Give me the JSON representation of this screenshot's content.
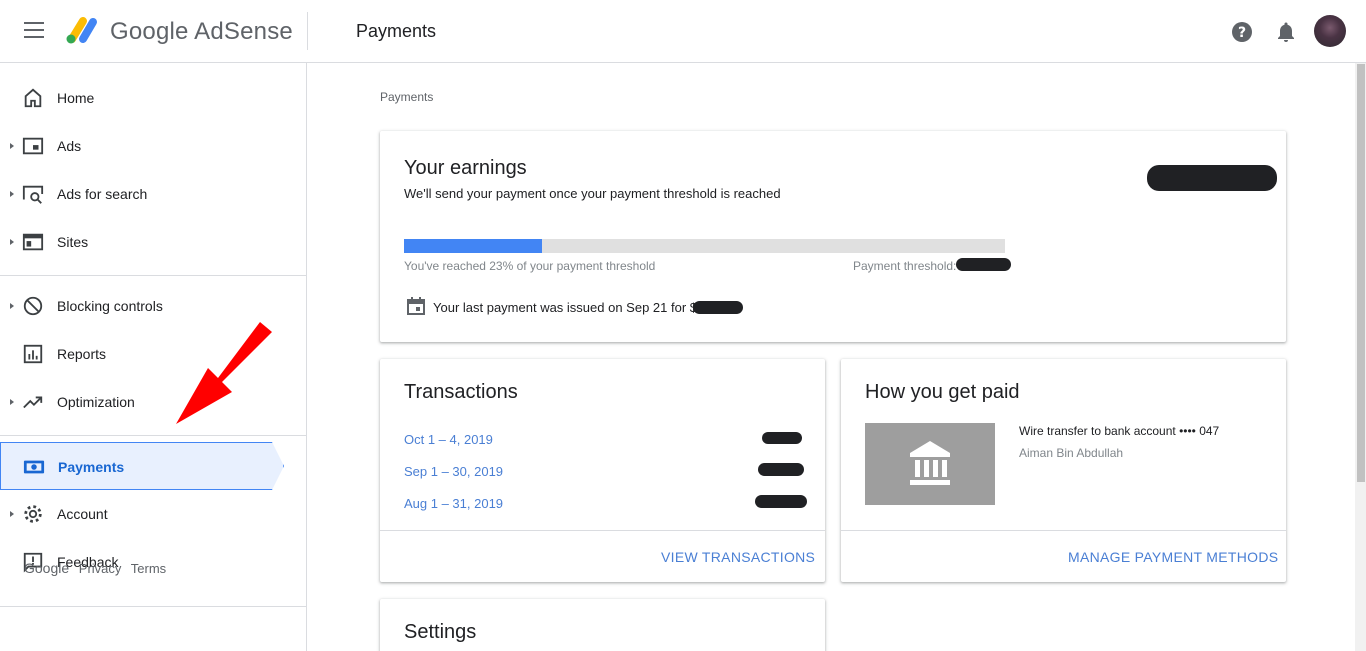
{
  "header": {
    "brand": "Google AdSense",
    "title": "Payments"
  },
  "sidebar": {
    "items": [
      {
        "label": "Home",
        "icon": "home-icon"
      },
      {
        "label": "Ads",
        "icon": "ads-icon"
      },
      {
        "label": "Ads for search",
        "icon": "ads-search-icon"
      },
      {
        "label": "Sites",
        "icon": "sites-icon"
      },
      {
        "label": "Blocking controls",
        "icon": "block-icon"
      },
      {
        "label": "Reports",
        "icon": "reports-icon"
      },
      {
        "label": "Optimization",
        "icon": "trending-icon"
      },
      {
        "label": "Payments",
        "icon": "payments-icon",
        "active": true
      },
      {
        "label": "Account",
        "icon": "gear-icon"
      },
      {
        "label": "Feedback",
        "icon": "feedback-icon"
      }
    ],
    "footer": {
      "google": "Google",
      "privacy": "Privacy",
      "terms": "Terms"
    }
  },
  "main": {
    "breadcrumb": "Payments",
    "earnings": {
      "title": "Your earnings",
      "subtitle": "We'll send your payment once your payment threshold is reached",
      "progress_percent": 23,
      "progress_text": "You've reached 23% of your payment threshold",
      "threshold_label": "Payment threshold:",
      "last_payment": "Your last payment was issued on Sep 21 for $"
    },
    "transactions": {
      "title": "Transactions",
      "rows": [
        "Oct 1 – 4, 2019",
        "Sep 1 – 30, 2019",
        "Aug 1 – 31, 2019"
      ],
      "action": "VIEW TRANSACTIONS"
    },
    "paid": {
      "title": "How you get paid",
      "method": "Wire transfer to bank account •••• 047",
      "holder": "Aiman Bin Abdullah",
      "action": "MANAGE PAYMENT METHODS"
    },
    "settings": {
      "title": "Settings"
    }
  },
  "colors": {
    "accent": "#4285f4",
    "link": "#4a7fd4",
    "active_bg": "#e8f0fe",
    "annotation": "#ff0000"
  }
}
